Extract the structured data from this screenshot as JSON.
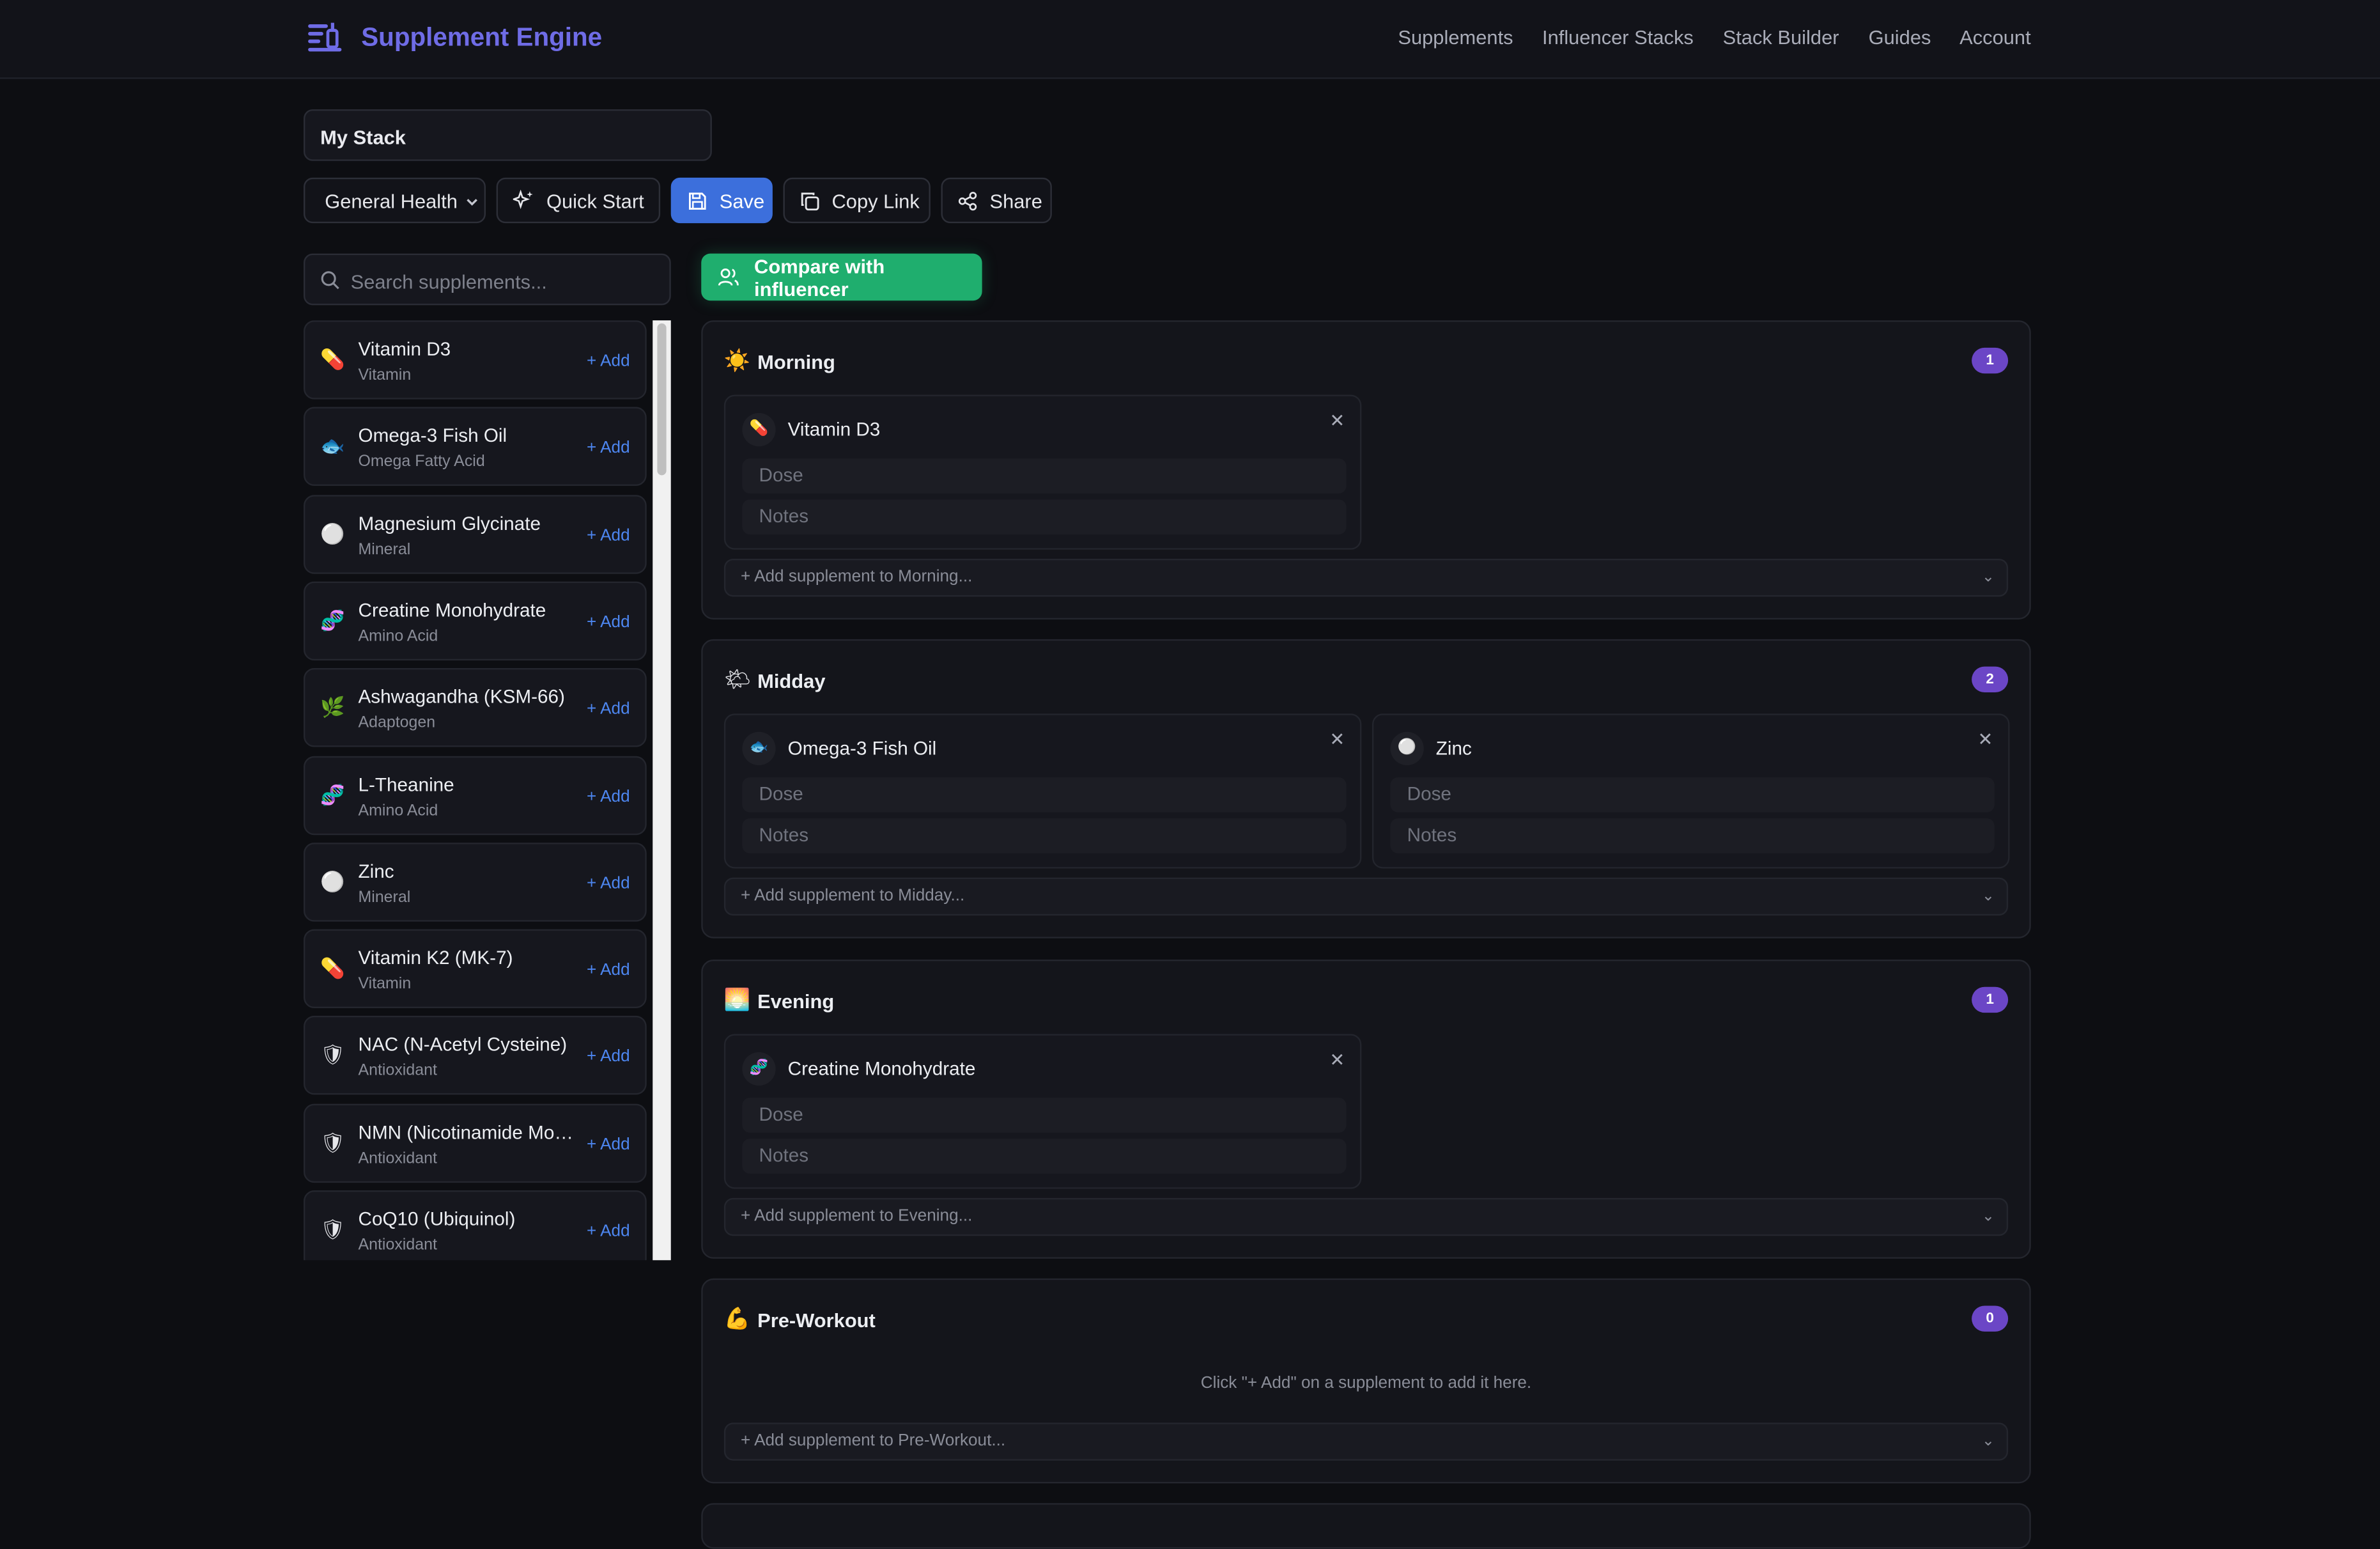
{
  "header": {
    "brand": "Supplement Engine",
    "nav": [
      "Supplements",
      "Influencer Stacks",
      "Stack Builder",
      "Guides",
      "Account"
    ]
  },
  "stack": {
    "name": "My Stack",
    "goal": "General Health"
  },
  "toolbar": {
    "quick_start": "Quick Start",
    "save": "Save",
    "copy_link": "Copy Link",
    "share": "Share"
  },
  "search": {
    "placeholder": "Search supplements..."
  },
  "compare_label": "Compare with influencer",
  "add_label": "+ Add",
  "supplements": [
    {
      "icon": "💊",
      "name": "Vitamin D3",
      "category": "Vitamin"
    },
    {
      "icon": "🐟",
      "name": "Omega-3 Fish Oil",
      "category": "Omega Fatty Acid"
    },
    {
      "icon": "⚪",
      "name": "Magnesium Glycinate",
      "category": "Mineral"
    },
    {
      "icon": "🧬",
      "name": "Creatine Monohydrate",
      "category": "Amino Acid"
    },
    {
      "icon": "🌿",
      "name": "Ashwagandha (KSM-66)",
      "category": "Adaptogen"
    },
    {
      "icon": "🧬",
      "name": "L-Theanine",
      "category": "Amino Acid"
    },
    {
      "icon": "⚪",
      "name": "Zinc",
      "category": "Mineral"
    },
    {
      "icon": "💊",
      "name": "Vitamin K2 (MK-7)",
      "category": "Vitamin"
    },
    {
      "icon": "🛡",
      "name": "NAC (N-Acetyl Cysteine)",
      "category": "Antioxidant"
    },
    {
      "icon": "🛡",
      "name": "NMN (Nicotinamide Mononucleotide)",
      "category": "Antioxidant"
    },
    {
      "icon": "🛡",
      "name": "CoQ10 (Ubiquinol)",
      "category": "Antioxidant"
    }
  ],
  "dose_placeholder": "Dose",
  "notes_placeholder": "Notes",
  "sections": [
    {
      "icon": "☀️",
      "title": "Morning",
      "count": "1",
      "items": [
        {
          "icon": "💊",
          "name": "Vitamin D3"
        }
      ],
      "add_text": "+ Add supplement to Morning..."
    },
    {
      "icon": "🌤",
      "title": "Midday",
      "count": "2",
      "items": [
        {
          "icon": "🐟",
          "name": "Omega-3 Fish Oil"
        },
        {
          "icon": "⚪",
          "name": "Zinc"
        }
      ],
      "add_text": "+ Add supplement to Midday..."
    },
    {
      "icon": "🌅",
      "title": "Evening",
      "count": "1",
      "items": [
        {
          "icon": "🧬",
          "name": "Creatine Monohydrate"
        }
      ],
      "add_text": "+ Add supplement to Evening..."
    },
    {
      "icon": "💪",
      "title": "Pre-Workout",
      "count": "0",
      "items": [],
      "empty_text": "Click \"+ Add\" on a supplement to add it here.",
      "add_text": "+ Add supplement to Pre-Workout..."
    }
  ]
}
